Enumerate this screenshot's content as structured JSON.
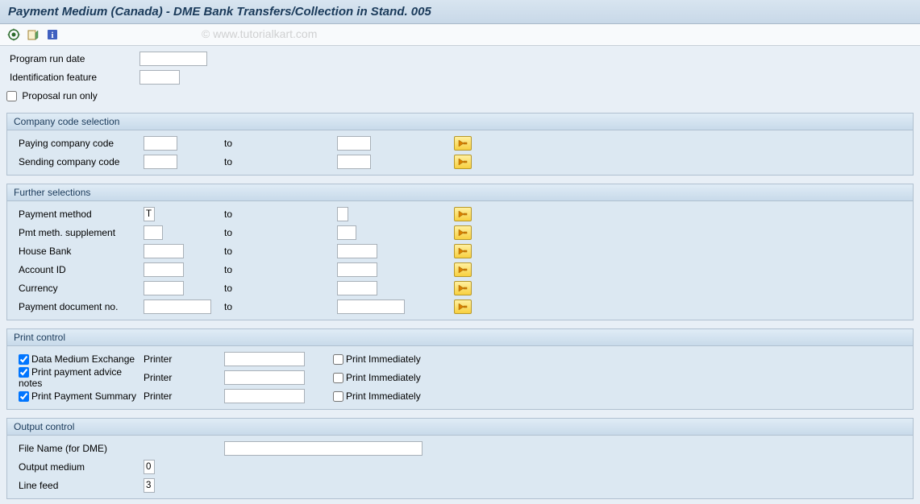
{
  "title": "Payment Medium (Canada) - DME Bank Transfers/Collection in Stand. 005",
  "watermark": "© www.tutorialkart.com",
  "top": {
    "program_run_date_label": "Program run date",
    "program_run_date": "",
    "ident_feature_label": "Identification feature",
    "ident_feature": "",
    "proposal_label": "Proposal run only"
  },
  "group_company": {
    "title": "Company code selection",
    "paying_label": "Paying company code",
    "paying_from": "",
    "paying_to": "",
    "sending_label": "Sending company code",
    "sending_from": "",
    "sending_to": "",
    "to_text": "to"
  },
  "group_further": {
    "title": "Further selections",
    "to_text": "to",
    "rows": [
      {
        "label": "Payment method",
        "from": "T",
        "to": "",
        "wf": 14,
        "wt": 14
      },
      {
        "label": "Pmt meth. supplement",
        "from": "",
        "to": "",
        "wf": 24,
        "wt": 24
      },
      {
        "label": "House Bank",
        "from": "",
        "to": "",
        "wf": 50,
        "wt": 50
      },
      {
        "label": "Account ID",
        "from": "",
        "to": "",
        "wf": 50,
        "wt": 50
      },
      {
        "label": "Currency",
        "from": "",
        "to": "",
        "wf": 50,
        "wt": 50
      },
      {
        "label": "Payment document no.",
        "from": "",
        "to": "",
        "wf": 84,
        "wt": 84
      }
    ]
  },
  "group_print": {
    "title": "Print control",
    "printer_label": "Printer",
    "immediate_label": "Print Immediately",
    "rows": [
      {
        "label": "Data Medium Exchange",
        "checked": true,
        "printer": "",
        "immediate": false
      },
      {
        "label": "Print payment advice notes",
        "checked": true,
        "printer": "",
        "immediate": false
      },
      {
        "label": "Print Payment Summary",
        "checked": true,
        "printer": "",
        "immediate": false
      }
    ]
  },
  "group_output": {
    "title": "Output control",
    "file_label": "File Name (for DME)",
    "file_value": "",
    "medium_label": "Output medium",
    "medium_value": "0",
    "linefeed_label": "Line feed",
    "linefeed_value": "3"
  }
}
